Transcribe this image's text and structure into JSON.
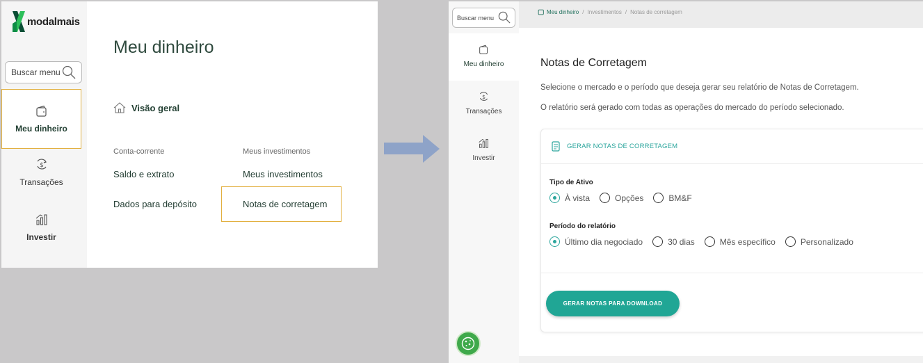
{
  "colors": {
    "accent": "#20a695",
    "highlight": "#e2b040",
    "brand_dark": "#234033",
    "cookie": "#3fa94b"
  },
  "left_panel": {
    "logo": "modalmais",
    "search_placeholder": "Buscar menu",
    "nav": [
      {
        "label": "Meu dinheiro",
        "icon": "wallet-icon",
        "active": true
      },
      {
        "label": "Transações",
        "icon": "dollar-exchange-icon"
      },
      {
        "label": "Investir",
        "icon": "bar-chart-icon"
      }
    ],
    "title": "Meu dinheiro",
    "overview": "Visão geral",
    "columns": [
      {
        "heading": "Conta-corrente",
        "links": [
          "Saldo e extrato",
          "Dados para depósito"
        ]
      },
      {
        "heading": "Meus investimentos",
        "links": [
          "Meus investimentos",
          "Notas de corretagem"
        ]
      }
    ]
  },
  "right_panel": {
    "search_placeholder": "Buscar menu",
    "nav": [
      {
        "label": "Meu dinheiro",
        "icon": "wallet-icon",
        "active": true
      },
      {
        "label": "Transações",
        "icon": "dollar-exchange-icon"
      },
      {
        "label": "Investir",
        "icon": "bar-chart-icon"
      }
    ],
    "breadcrumb": [
      "Meu dinheiro",
      "Investimentos",
      "Notas de corretagem"
    ],
    "breadcrumb_sep": "/",
    "title": "Notas de Corretagem",
    "desc1": "Selecione o mercado e o período que deseja gerar seu relatório de Notas de Corretagem.",
    "desc2": "O relatório será gerado com todas as operações do mercado do período selecionado.",
    "card": {
      "header": "GERAR NOTAS DE CORRETAGEM",
      "asset_label": "Tipo de Ativo",
      "asset_options": [
        "À vista",
        "Opções",
        "BM&F"
      ],
      "asset_selected": "À vista",
      "period_label": "Período do relatório",
      "period_options": [
        "Último dia negociado",
        "30 dias",
        "Mês específico",
        "Personalizado"
      ],
      "period_selected": "Último dia negociado",
      "button": "GERAR NOTAS PARA DOWNLOAD"
    }
  }
}
